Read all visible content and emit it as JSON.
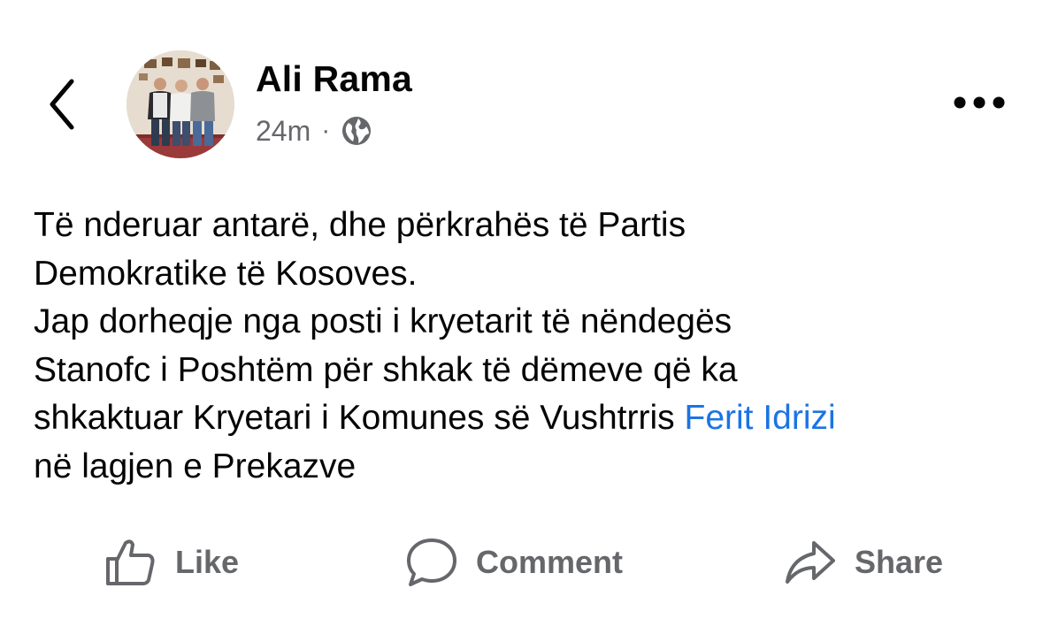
{
  "header": {
    "back_icon": "chevron-left-icon",
    "author_name": "Ali Rama",
    "timestamp": "24m",
    "separator": "·",
    "audience_icon": "globe-icon",
    "more_icon": "more-horizontal-icon"
  },
  "post": {
    "line_1": "Të nderuar antarë, dhe përkrahës të Partis",
    "line_2": "Demokratike të Kosoves.",
    "line_3": "Jap dorheqje nga posti i kryetarit të nëndegës",
    "line_4": "Stanofc i Poshtëm për shkak të dëmeve që ka",
    "line_5_text": "shkaktuar Kryetari i Komunes së Vushtrris ",
    "line_5_mention": "Ferit Idrizi",
    "line_6": "në lagjen e Prekazve"
  },
  "actions": {
    "like_label": "Like",
    "comment_label": "Comment",
    "share_label": "Share"
  },
  "colors": {
    "text": "#050505",
    "secondary": "#65676b",
    "link": "#1b74e4",
    "background": "#ffffff"
  }
}
